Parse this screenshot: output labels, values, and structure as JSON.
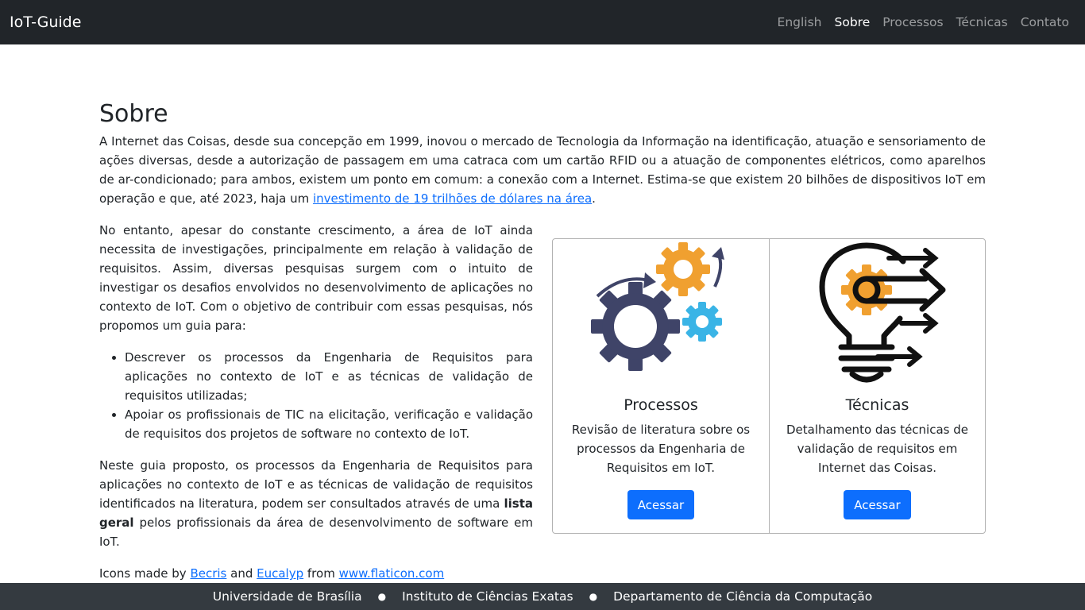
{
  "navbar": {
    "brand": "IoT-Guide",
    "links": [
      {
        "label": "English",
        "active": false
      },
      {
        "label": "Sobre",
        "active": true
      },
      {
        "label": "Processos",
        "active": false
      },
      {
        "label": "Técnicas",
        "active": false
      },
      {
        "label": "Contato",
        "active": false
      }
    ]
  },
  "main": {
    "title": "Sobre",
    "intro_before_link": "A Internet das Coisas, desde sua concepção em 1999, inovou o mercado de Tecnologia da Informação na identificação, atuação e sensoriamento de ações diversas, desde a autorização de passagem em uma catraca com um cartão RFID ou a atuação de componentes elétricos, como aparelhos de ar-condicionado; para ambos, existem um ponto em comum: a conexão com a Internet. Estima-se que existem 20 bilhões de dispositivos IoT em operação e que, até 2023, haja um ",
    "intro_link": "investimento de 19 trilhões de dólares na área",
    "intro_after_link": ".",
    "para2": "No entanto, apesar do constante crescimento, a área de IoT ainda necessita de investigações, principalmente em relação à validação de requisitos. Assim, diversas pesquisas surgem com o intuito de investigar os desafios envolvidos no desenvolvimento de aplicações no contexto de IoT. Com o objetivo de contribuir com essas pesquisas, nós propomos um guia para:",
    "bullets": [
      "Descrever os processos da Engenharia de Requisitos para aplicações no contexto de IoT e as técnicas de validação de requisitos utilizadas;",
      "Apoiar os profissionais de TIC na elicitação, verificação e validação de requisitos dos projetos de software no contexto de IoT."
    ],
    "para3_before": "Neste guia proposto, os processos da Engenharia de Requisitos para aplicações no contexto de IoT e as técnicas de validação de requisitos identificados na literatura, podem ser consultados através de uma ",
    "para3_bold": "lista geral",
    "para3_after": " pelos profissionais da área de desenvolvimento de software em IoT.",
    "credits": {
      "prefix": "Icons made by ",
      "author1": "Becris",
      "and": " and ",
      "author2": "Eucalyp",
      "from": " from ",
      "site": "www.flaticon.com"
    }
  },
  "cards": [
    {
      "icon": "gears-icon",
      "title": "Processos",
      "text": "Revisão de literatura sobre os processos da Engenharia de Requisitos em IoT.",
      "button": "Acessar"
    },
    {
      "icon": "lightbulb-arrows-icon",
      "title": "Técnicas",
      "text": "Detalhamento das técnicas de validação de requisitos em Internet das Coisas.",
      "button": "Acessar"
    }
  ],
  "footer": {
    "items": [
      "Universidade de Brasília",
      "Instituto de Ciências Exatas",
      "Departamento de Ciência da Computação"
    ],
    "separator": "●"
  },
  "colors": {
    "navbar_bg": "#212529",
    "footer_bg": "#343a40",
    "primary": "#0d6efd",
    "gear_orange": "#f0a030",
    "gear_navy": "#3f4468",
    "gear_blue": "#3ab4e6"
  }
}
